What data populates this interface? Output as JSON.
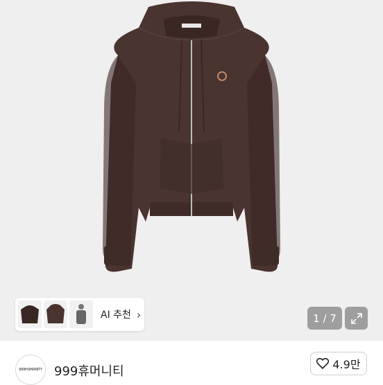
{
  "gallery": {
    "counter": "1 / 7",
    "ai_recommend_label": "AI 추천",
    "chevron_glyph": "›",
    "thumbnails": [
      "hoodie-front-thumb",
      "hoodie-back-thumb",
      "model-wearing-thumb"
    ]
  },
  "seller": {
    "avatar_text": "999HUMANITY",
    "shop_name": "999휴머니티",
    "likes": "4.9만"
  },
  "colors": {
    "background": "#efefef",
    "hoodie": "#4a3430",
    "hoodie_shadow": "#3a2724"
  }
}
